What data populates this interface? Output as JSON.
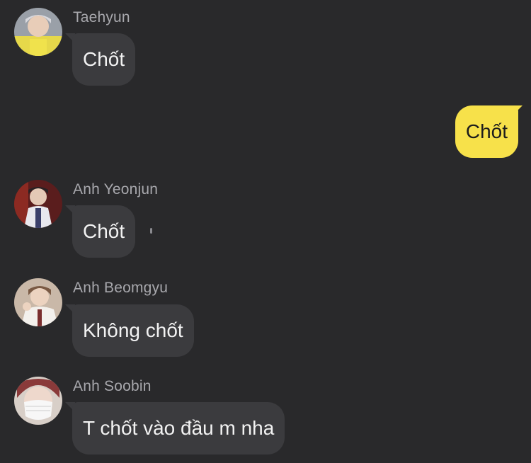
{
  "messages": [
    {
      "sender": "Taehyun",
      "text": "Chốt",
      "direction": "incoming",
      "avatar_icon": "avatar-taehyun"
    },
    {
      "sender": "",
      "text": "Chốt",
      "direction": "outgoing"
    },
    {
      "sender": "Anh Yeonjun",
      "text": "Chốt",
      "direction": "incoming",
      "avatar_icon": "avatar-yeonjun"
    },
    {
      "sender": "Anh Beomgyu",
      "text": "Không chốt",
      "direction": "incoming",
      "avatar_icon": "avatar-beomgyu"
    },
    {
      "sender": "Anh Soobin",
      "text": "T chốt vào đầu m nha",
      "direction": "incoming",
      "avatar_icon": "avatar-soobin"
    }
  ],
  "colors": {
    "background": "#29292b",
    "incoming_bubble": "#3b3b3e",
    "outgoing_bubble": "#f7e14a",
    "sender_text": "#a8a8ad"
  }
}
